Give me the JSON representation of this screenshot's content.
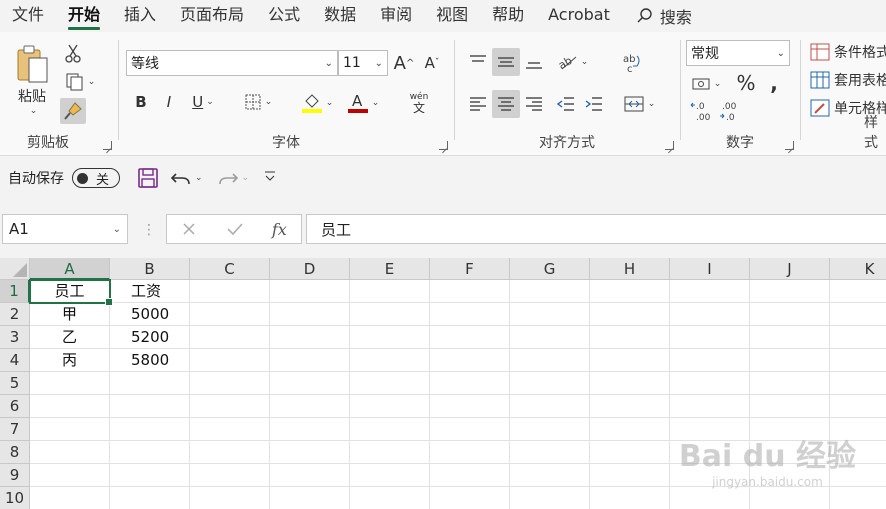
{
  "tabs": [
    "文件",
    "开始",
    "插入",
    "页面布局",
    "公式",
    "数据",
    "审阅",
    "视图",
    "帮助",
    "Acrobat"
  ],
  "active_tab": "开始",
  "search_label": "搜索",
  "ribbon": {
    "clipboard": {
      "label": "剪贴板",
      "paste_label": "粘贴"
    },
    "font": {
      "label": "字体",
      "font_name": "等线",
      "font_size": "11",
      "phonetic_label": "wén",
      "phonetic_char": "文"
    },
    "alignment": {
      "label": "对齐方式"
    },
    "number": {
      "label": "数字",
      "format": "常规"
    },
    "styles": {
      "label": "样式",
      "items": [
        "条件格式",
        "套用表格",
        "单元格样"
      ]
    }
  },
  "qat": {
    "autosave_label": "自动保存",
    "toggle_state": "关"
  },
  "formula_bar": {
    "name_box": "A1",
    "fx_label": "fx",
    "content": "员工"
  },
  "columns": [
    "A",
    "B",
    "C",
    "D",
    "E",
    "F",
    "G",
    "H",
    "I",
    "J",
    "K"
  ],
  "rows": [
    "1",
    "2",
    "3",
    "4",
    "5",
    "6",
    "7",
    "8",
    "9",
    "10"
  ],
  "cells": [
    [
      "员工",
      "工资"
    ],
    [
      "甲",
      "5000"
    ],
    [
      "乙",
      "5200"
    ],
    [
      "丙",
      "5800"
    ]
  ],
  "watermark": {
    "main": "Bai du 经验",
    "sub": "jingyan.baidu.com"
  },
  "colors": {
    "accent": "#217346",
    "font_color": "#c00000",
    "highlight": "#ffff00"
  }
}
